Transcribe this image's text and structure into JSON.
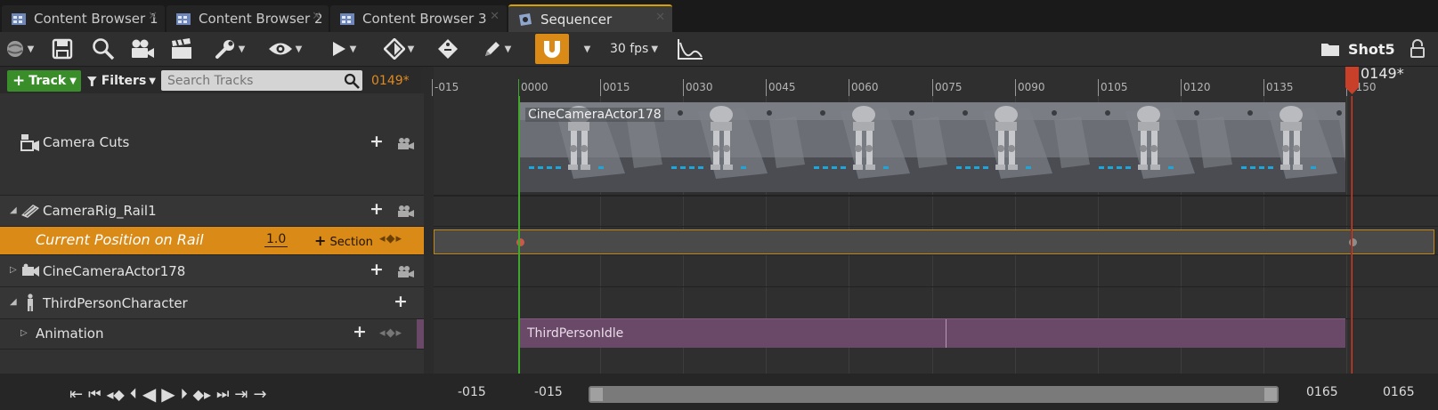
{
  "tabs": [
    {
      "label": "Content Browser 1",
      "active": false
    },
    {
      "label": "Content Browser 2",
      "active": false
    },
    {
      "label": "Content Browser 3",
      "active": false
    },
    {
      "label": "Sequencer",
      "active": true
    }
  ],
  "toolbar": {
    "framerate": "30 fps",
    "sequence_name": "Shot5",
    "icons": [
      "world-icon",
      "save-icon",
      "search-icon",
      "camera-icon",
      "clapperboard-icon",
      "wrench-icon",
      "eye-icon",
      "play-icon",
      "key-icon",
      "key-tag-icon",
      "pencil-icon",
      "magnet-snap-icon",
      "curve-editor-icon",
      "folder-icon",
      "lock-icon"
    ]
  },
  "filterbar": {
    "track_button": "Track",
    "filters_button": "Filters",
    "search_placeholder": "Search Tracks",
    "current_frame": "0149*"
  },
  "tree": {
    "camera_cuts": "Camera Cuts",
    "camera_rig": "CameraRig_Rail1",
    "current_position": {
      "label": "Current Position on Rail",
      "value": "1.0",
      "section_button": "Section"
    },
    "cine_camera": "CineCameraActor178",
    "third_person": "ThirdPersonCharacter",
    "animation": "Animation"
  },
  "ruler": {
    "labels": [
      "-015",
      "0000",
      "0015",
      "0030",
      "0045",
      "0060",
      "0075",
      "0090",
      "0105",
      "0120",
      "0135",
      "0150"
    ],
    "playhead_label": "0149*"
  },
  "timeline": {
    "camera_section_label": "CineCameraActor178",
    "animation_section_label": "ThirdPersonIdle"
  },
  "playback_range": {
    "view_start": "-015",
    "work_start": "-015",
    "work_end": "0165",
    "view_end": "0165"
  },
  "colors": {
    "accent_orange": "#d98a17",
    "tab_highlight": "#d6a100",
    "start_marker": "#3fa82b",
    "playhead": "#c8402a",
    "animation_section": "#6a4868"
  }
}
